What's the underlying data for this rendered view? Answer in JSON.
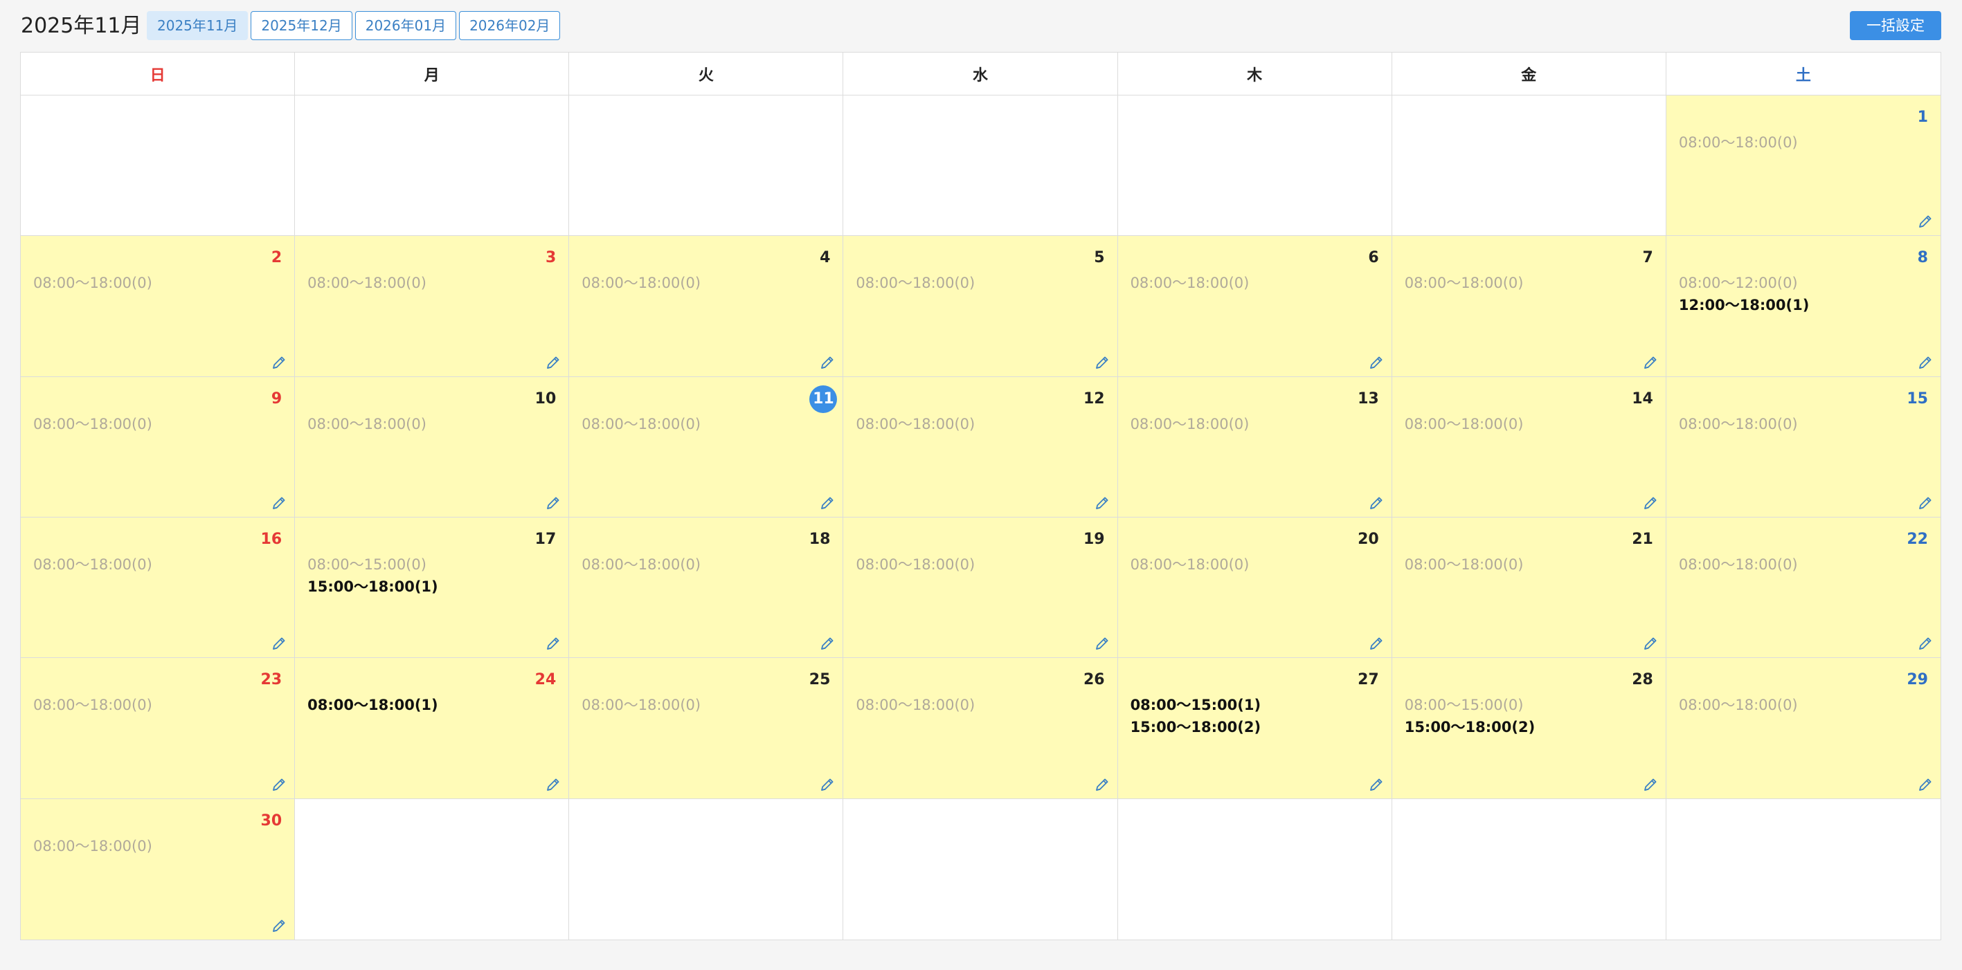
{
  "header": {
    "title": "2025年11月",
    "tabs": [
      {
        "label": "2025年11月",
        "active": true
      },
      {
        "label": "2025年12月",
        "active": false
      },
      {
        "label": "2026年01月",
        "active": false
      },
      {
        "label": "2026年02月",
        "active": false
      }
    ],
    "bulk_label": "一括設定"
  },
  "colors": {
    "accent": "#3b8fe5",
    "sunday": "#e53935",
    "saturday": "#2f6fc4",
    "available_bg": "#fffbb8",
    "muted_slot": "#b0a99a"
  },
  "icons": {
    "edit": "pencil-icon"
  },
  "weekdays": [
    {
      "label": "日",
      "kind": "sun"
    },
    {
      "label": "月",
      "kind": ""
    },
    {
      "label": "火",
      "kind": ""
    },
    {
      "label": "水",
      "kind": ""
    },
    {
      "label": "木",
      "kind": ""
    },
    {
      "label": "金",
      "kind": ""
    },
    {
      "label": "土",
      "kind": "sat"
    }
  ],
  "today": 11,
  "days": [
    {
      "day": 1,
      "slots": [
        {
          "t": "08:00〜18:00(0)",
          "b": false
        }
      ]
    },
    {
      "day": 2,
      "slots": [
        {
          "t": "08:00〜18:00(0)",
          "b": false
        }
      ]
    },
    {
      "day": 3,
      "holiday": true,
      "slots": [
        {
          "t": "08:00〜18:00(0)",
          "b": false
        }
      ]
    },
    {
      "day": 4,
      "slots": [
        {
          "t": "08:00〜18:00(0)",
          "b": false
        }
      ]
    },
    {
      "day": 5,
      "slots": [
        {
          "t": "08:00〜18:00(0)",
          "b": false
        }
      ]
    },
    {
      "day": 6,
      "slots": [
        {
          "t": "08:00〜18:00(0)",
          "b": false
        }
      ]
    },
    {
      "day": 7,
      "slots": [
        {
          "t": "08:00〜18:00(0)",
          "b": false
        }
      ]
    },
    {
      "day": 8,
      "slots": [
        {
          "t": "08:00〜12:00(0)",
          "b": false
        },
        {
          "t": "12:00〜18:00(1)",
          "b": true
        }
      ]
    },
    {
      "day": 9,
      "slots": [
        {
          "t": "08:00〜18:00(0)",
          "b": false
        }
      ]
    },
    {
      "day": 10,
      "slots": [
        {
          "t": "08:00〜18:00(0)",
          "b": false
        }
      ]
    },
    {
      "day": 11,
      "slots": [
        {
          "t": "08:00〜18:00(0)",
          "b": false
        }
      ]
    },
    {
      "day": 12,
      "slots": [
        {
          "t": "08:00〜18:00(0)",
          "b": false
        }
      ]
    },
    {
      "day": 13,
      "slots": [
        {
          "t": "08:00〜18:00(0)",
          "b": false
        }
      ]
    },
    {
      "day": 14,
      "slots": [
        {
          "t": "08:00〜18:00(0)",
          "b": false
        }
      ]
    },
    {
      "day": 15,
      "slots": [
        {
          "t": "08:00〜18:00(0)",
          "b": false
        }
      ]
    },
    {
      "day": 16,
      "slots": [
        {
          "t": "08:00〜18:00(0)",
          "b": false
        }
      ]
    },
    {
      "day": 17,
      "slots": [
        {
          "t": "08:00〜15:00(0)",
          "b": false
        },
        {
          "t": "15:00〜18:00(1)",
          "b": true
        }
      ]
    },
    {
      "day": 18,
      "slots": [
        {
          "t": "08:00〜18:00(0)",
          "b": false
        }
      ]
    },
    {
      "day": 19,
      "slots": [
        {
          "t": "08:00〜18:00(0)",
          "b": false
        }
      ]
    },
    {
      "day": 20,
      "slots": [
        {
          "t": "08:00〜18:00(0)",
          "b": false
        }
      ]
    },
    {
      "day": 21,
      "slots": [
        {
          "t": "08:00〜18:00(0)",
          "b": false
        }
      ]
    },
    {
      "day": 22,
      "slots": [
        {
          "t": "08:00〜18:00(0)",
          "b": false
        }
      ]
    },
    {
      "day": 23,
      "slots": [
        {
          "t": "08:00〜18:00(0)",
          "b": false
        }
      ]
    },
    {
      "day": 24,
      "holiday": true,
      "slots": [
        {
          "t": "08:00〜18:00(1)",
          "b": true
        }
      ]
    },
    {
      "day": 25,
      "slots": [
        {
          "t": "08:00〜18:00(0)",
          "b": false
        }
      ]
    },
    {
      "day": 26,
      "slots": [
        {
          "t": "08:00〜18:00(0)",
          "b": false
        }
      ]
    },
    {
      "day": 27,
      "slots": [
        {
          "t": "08:00〜15:00(1)",
          "b": true
        },
        {
          "t": "15:00〜18:00(2)",
          "b": true
        }
      ]
    },
    {
      "day": 28,
      "slots": [
        {
          "t": "08:00〜15:00(0)",
          "b": false
        },
        {
          "t": "15:00〜18:00(2)",
          "b": true
        }
      ]
    },
    {
      "day": 29,
      "slots": [
        {
          "t": "08:00〜18:00(0)",
          "b": false
        }
      ]
    },
    {
      "day": 30,
      "slots": [
        {
          "t": "08:00〜18:00(0)",
          "b": false
        }
      ]
    }
  ]
}
